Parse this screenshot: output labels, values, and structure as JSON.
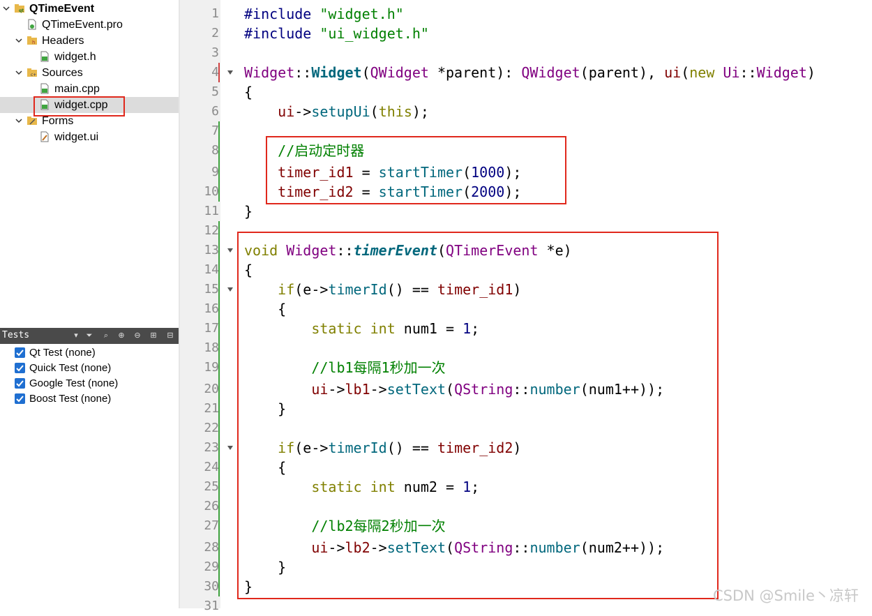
{
  "project_tree": {
    "project": "QTimeEvent",
    "pro_file": "QTimeEvent.pro",
    "headers": "Headers",
    "header_file": "widget.h",
    "sources": "Sources",
    "source_main": "main.cpp",
    "source_widget": "widget.cpp",
    "forms": "Forms",
    "form_file": "widget.ui"
  },
  "tests": {
    "title": "Tests",
    "items": [
      "Qt Test (none)",
      "Quick Test (none)",
      "Google Test (none)",
      "Boost Test (none)"
    ]
  },
  "editor": {
    "line_numbers": [
      "1",
      "2",
      "3",
      "4",
      "5",
      "6",
      "7",
      "8",
      "9",
      "10",
      "11",
      "12",
      "13",
      "14",
      "15",
      "16",
      "17",
      "18",
      "19",
      "20",
      "21",
      "22",
      "23",
      "24",
      "25",
      "26",
      "27",
      "28",
      "29",
      "30",
      "31"
    ],
    "lines": {
      "l1": [
        "#include",
        " ",
        "\"widget.h\""
      ],
      "l2": [
        "#include",
        " ",
        "\"ui_widget.h\""
      ],
      "l4": [
        "Widget",
        "::",
        "Widget",
        "(",
        "QWidget",
        " *parent): ",
        "QWidget",
        "(parent), ",
        "ui",
        "(",
        "new",
        " ",
        "Ui",
        "::",
        "Widget",
        ")"
      ],
      "l5": "{",
      "l6": [
        "    ",
        "ui",
        "->",
        "setupUi",
        "(",
        "this",
        ");"
      ],
      "l8": "    //启动定时器",
      "l9": [
        "    ",
        "timer_id1",
        " = ",
        "startTimer",
        "(",
        "1000",
        ");"
      ],
      "l10": [
        "    ",
        "timer_id2",
        " = ",
        "startTimer",
        "(",
        "2000",
        ");"
      ],
      "l11": "}",
      "l13": [
        "void",
        " ",
        "Widget",
        "::",
        "timerEvent",
        "(",
        "QTimerEvent",
        " *e)"
      ],
      "l14": "{",
      "l15": [
        "    ",
        "if",
        "(e->",
        "timerId",
        "() == ",
        "timer_id1",
        ")"
      ],
      "l16": "    {",
      "l17": [
        "        ",
        "static",
        " ",
        "int",
        " num1 = ",
        "1",
        ";"
      ],
      "l19": "        //lb1每隔1秒加一次",
      "l20": [
        "        ",
        "ui",
        "->",
        "lb1",
        "->",
        "setText",
        "(",
        "QString",
        "::",
        "number",
        "(num1++));"
      ],
      "l21": "    }",
      "l23": [
        "    ",
        "if",
        "(e->",
        "timerId",
        "() == ",
        "timer_id2",
        ")"
      ],
      "l24": "    {",
      "l25": [
        "        ",
        "static",
        " ",
        "int",
        " num2 = ",
        "1",
        ";"
      ],
      "l27": "        //lb2每隔2秒加一次",
      "l28": [
        "        ",
        "ui",
        "->",
        "lb2",
        "->",
        "setText",
        "(",
        "QString",
        "::",
        "number",
        "(num2++));"
      ],
      "l29": "    }",
      "l30": "}"
    }
  },
  "watermark": "CSDN @Smile丶凉轩",
  "colors": {
    "highlight_box": "#e0281c",
    "keyword": "#808000",
    "string": "#008000",
    "class": "#800080",
    "function": "#00677c",
    "member": "#800000",
    "number": "#000080"
  }
}
